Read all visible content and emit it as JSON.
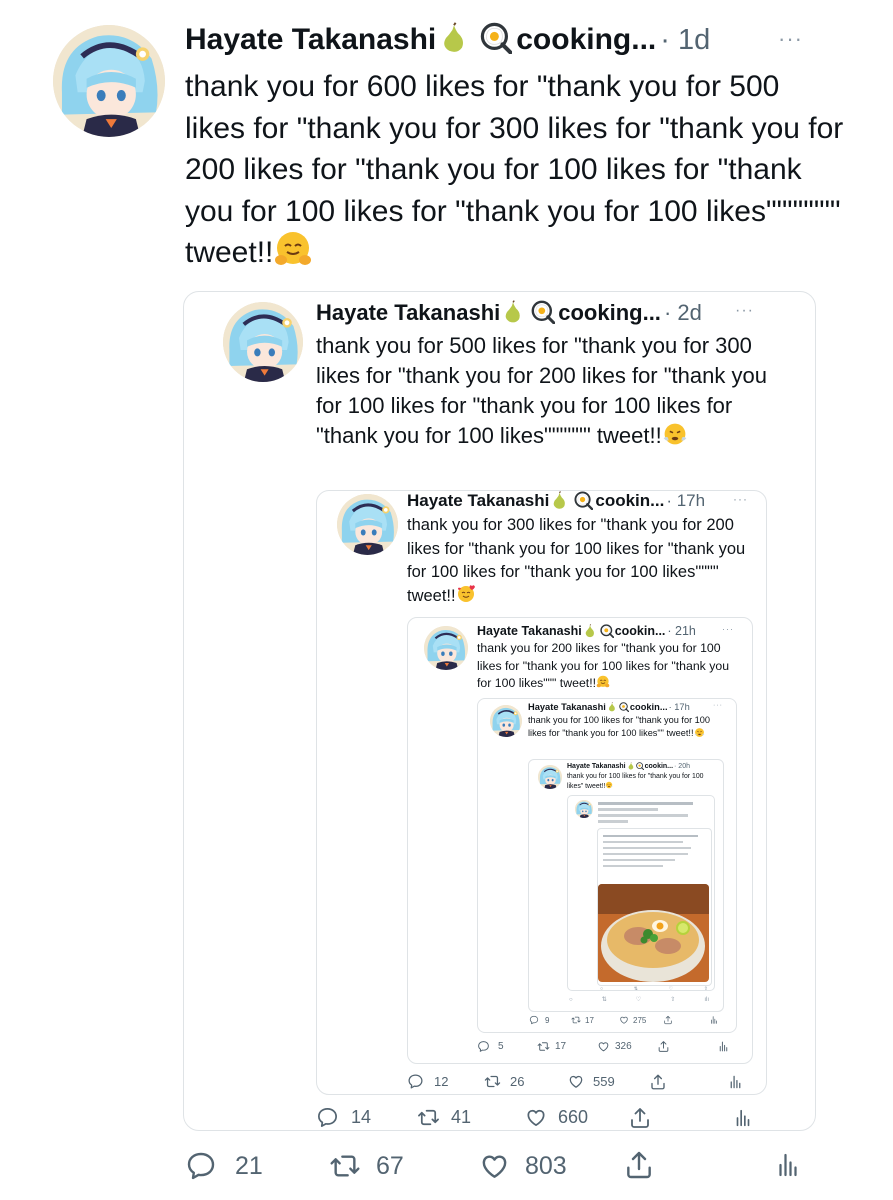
{
  "tweet": {
    "author": "Hayate Takanashi",
    "handle": "cooking...",
    "time": "· 1d",
    "text": "thank you for 600 likes for \"thank you for 500 likes for \"thank you for 300 likes for \"thank you for 200 likes for \"thank you for 100 likes for \"thank you for 100 likes for \"thank you for 100 likes\"\"\"\"\"\"\" tweet!!",
    "reply_count": "21",
    "retweet_count": "67",
    "like_count": "803"
  },
  "quote1": {
    "author": "Hayate Takanashi",
    "handle": "cooking...",
    "time": "· 2d",
    "text": "thank you for 500 likes for \"thank you for 300 likes for \"thank you for 200 likes for \"thank you for 100 likes for \"thank you for 100 likes for \"thank you for 100 likes\"\"\"\"\"\" tweet!!",
    "reply_count": "14",
    "retweet_count": "41",
    "like_count": "660"
  },
  "quote2": {
    "author": "Hayate Takanashi",
    "handle": "cookin...",
    "time": "· 17h",
    "text": "thank you for 300 likes for \"thank you for 200 likes for \"thank you for 100 likes for \"thank you for 100 likes for \"thank you for 100 likes\"\"\"\" tweet!!",
    "reply_count": "12",
    "retweet_count": "26",
    "like_count": "559"
  },
  "quote3": {
    "author": "Hayate Takanashi",
    "handle": "cookin...",
    "time": "· 21h",
    "text": "thank you for 200 likes for \"thank you for 100 likes for \"thank you for 100 likes for \"thank you for 100 likes\"\"\" tweet!!",
    "reply_count": "5",
    "retweet_count": "17",
    "like_count": "326"
  },
  "quote4": {
    "author": "Hayate Takanashi",
    "handle": "cookin...",
    "time": "· 17h",
    "text": "thank you for 100 likes for \"thank you for 100 likes for \"thank you for 100 likes\"\" tweet!!",
    "reply_count": "9",
    "retweet_count": "17",
    "like_count": "275"
  },
  "quote5": {
    "author": "Hayate Takanashi",
    "handle": "cookin...",
    "time": "· 20h",
    "text": "thank you for 100 likes for \"thank you for 100 likes\" tweet!!"
  },
  "colors": {
    "text": "#0f1419",
    "muted": "#536471",
    "border": "#dfe3e6"
  },
  "icons": [
    "pear-emoji",
    "fried-egg-emoji",
    "hug-emoji",
    "steam-emoji",
    "smiling-hearts-emoji",
    "reply-icon",
    "retweet-icon",
    "like-icon",
    "share-icon",
    "analytics-icon",
    "more-icon"
  ]
}
